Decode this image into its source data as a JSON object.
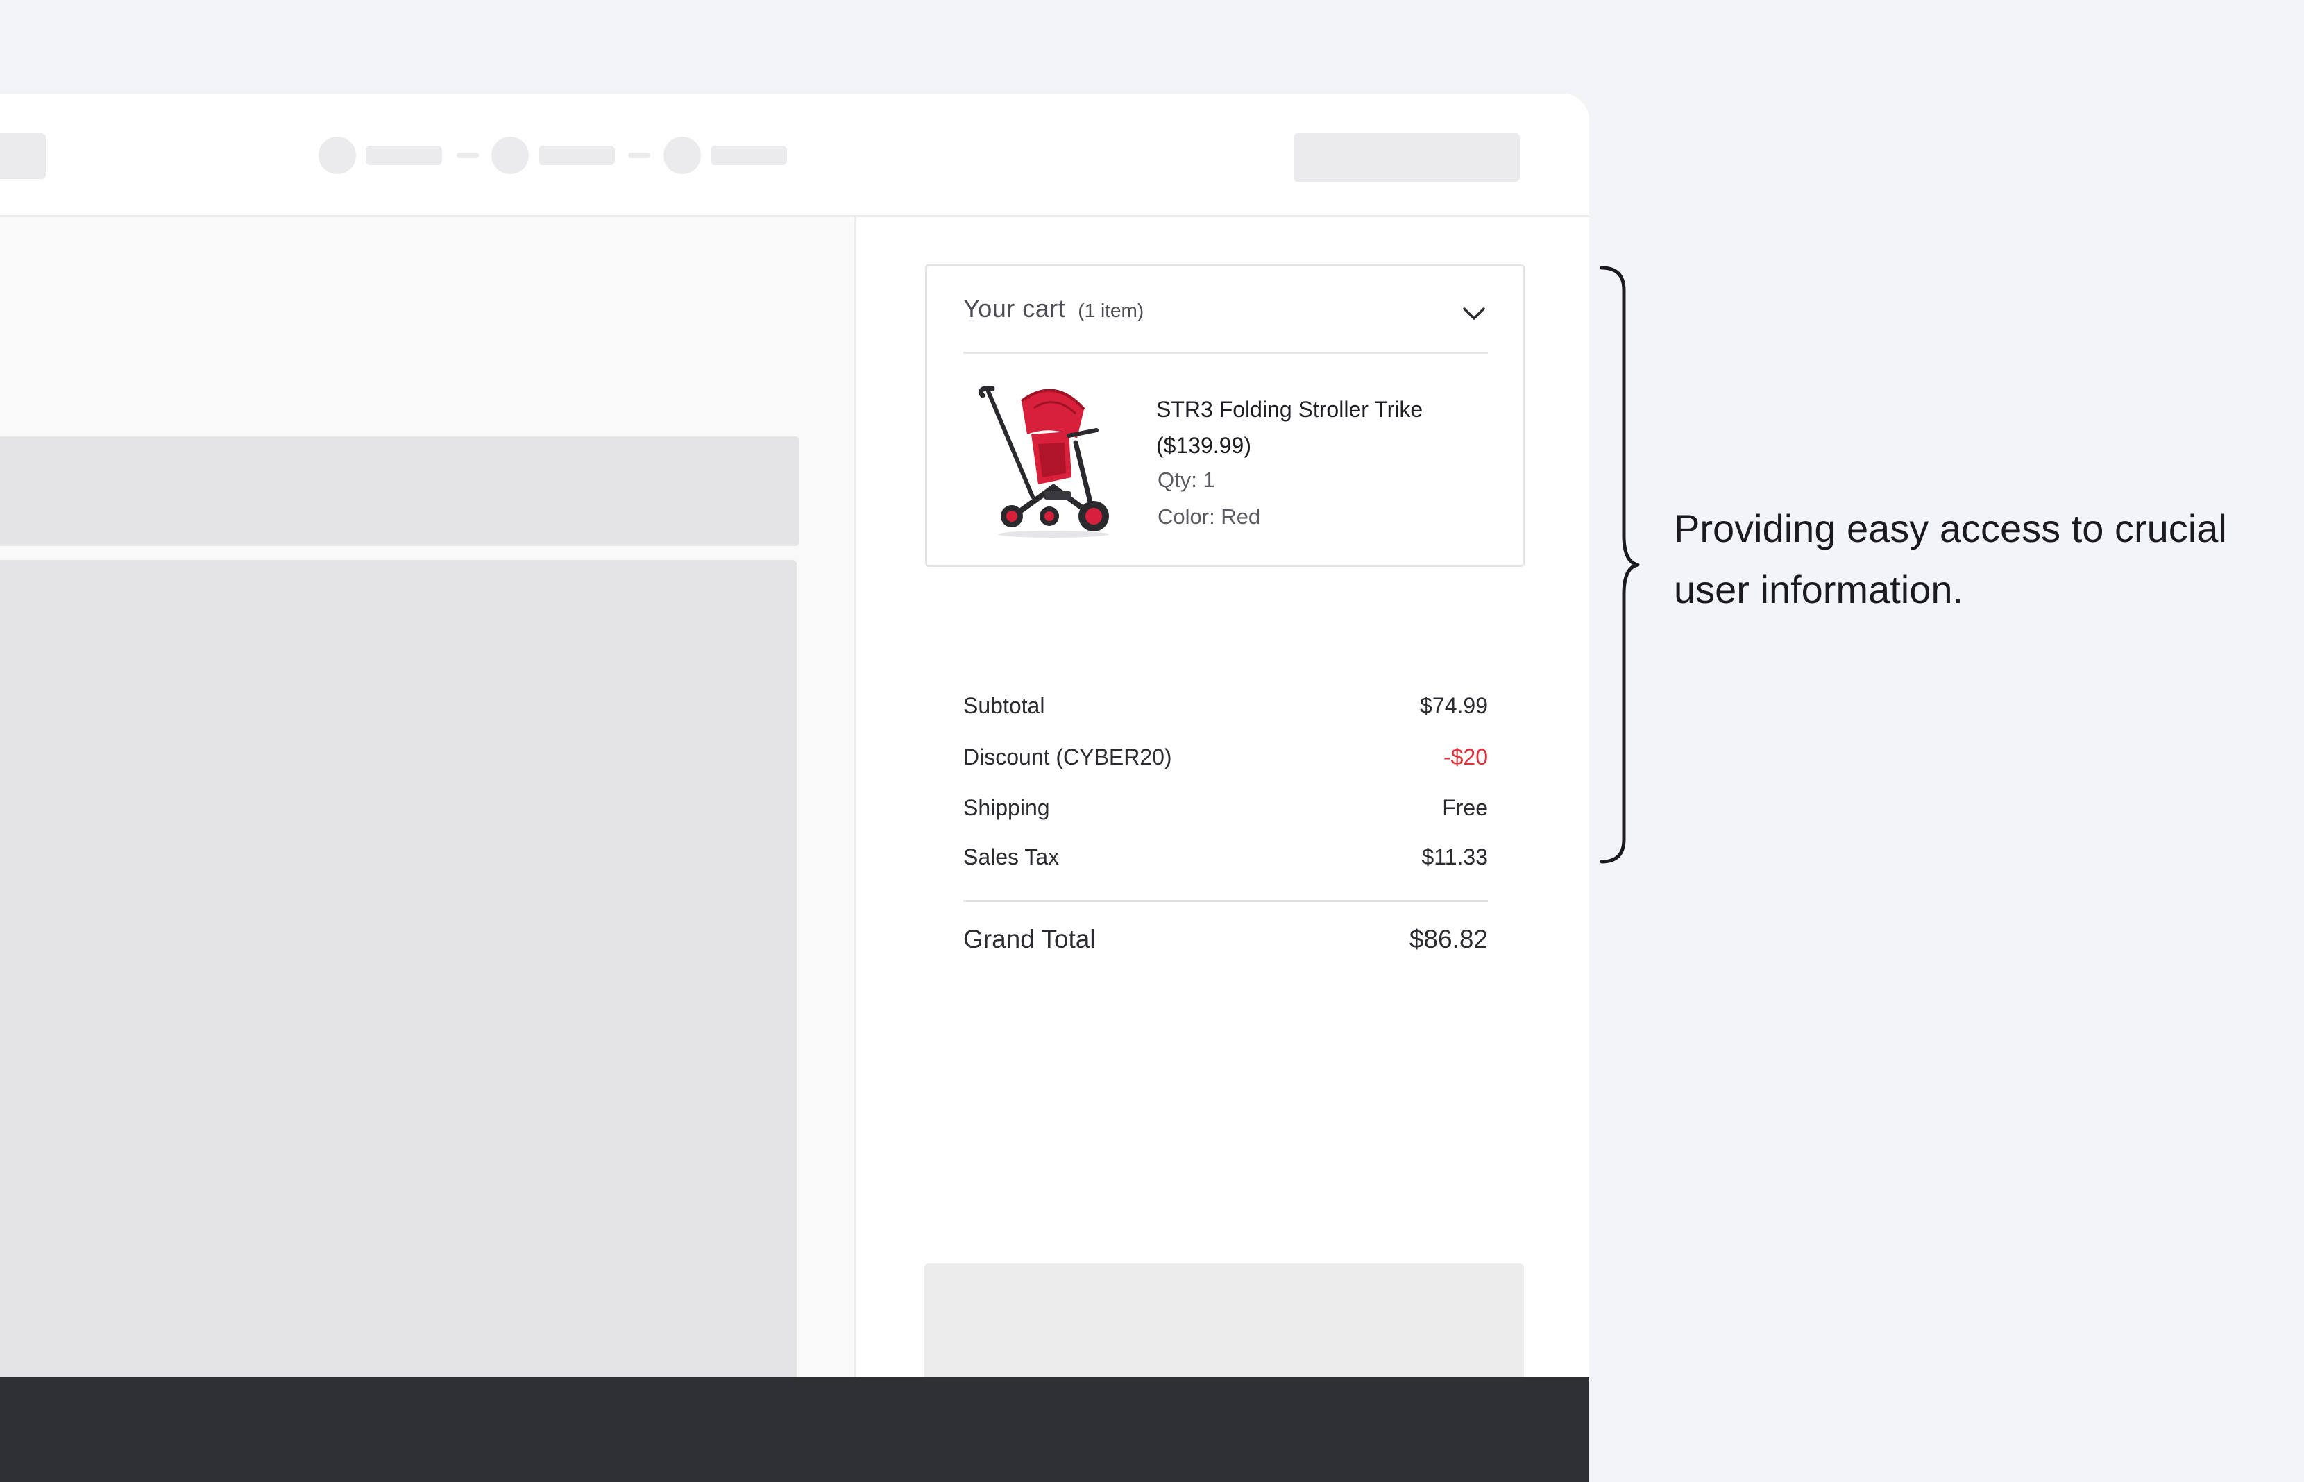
{
  "cart": {
    "title": "Your cart",
    "count": "(1 item)",
    "product": {
      "name": "STR3 Folding Stroller Trike ($139.99)",
      "qty": "Qty: 1",
      "color": "Color: Red"
    }
  },
  "summary": {
    "subtotal_label": "Subtotal",
    "subtotal_value": "$74.99",
    "discount_label": "Discount (CYBER20)",
    "discount_value": "-$20",
    "shipping_label": "Shipping",
    "shipping_value": "Free",
    "tax_label": "Sales Tax",
    "tax_value": "$11.33",
    "grand_label": "Grand Total",
    "grand_value": "$86.82"
  },
  "annotation": {
    "text": "Providing easy access to crucial user information."
  },
  "colors": {
    "background": "#f3f4f8",
    "discount": "#e0303a",
    "footer": "#2f3034",
    "product_red": "#d8203a"
  },
  "icons": {
    "cart_toggle": "chevron-down-icon",
    "annotation": "curly-brace-icon"
  }
}
